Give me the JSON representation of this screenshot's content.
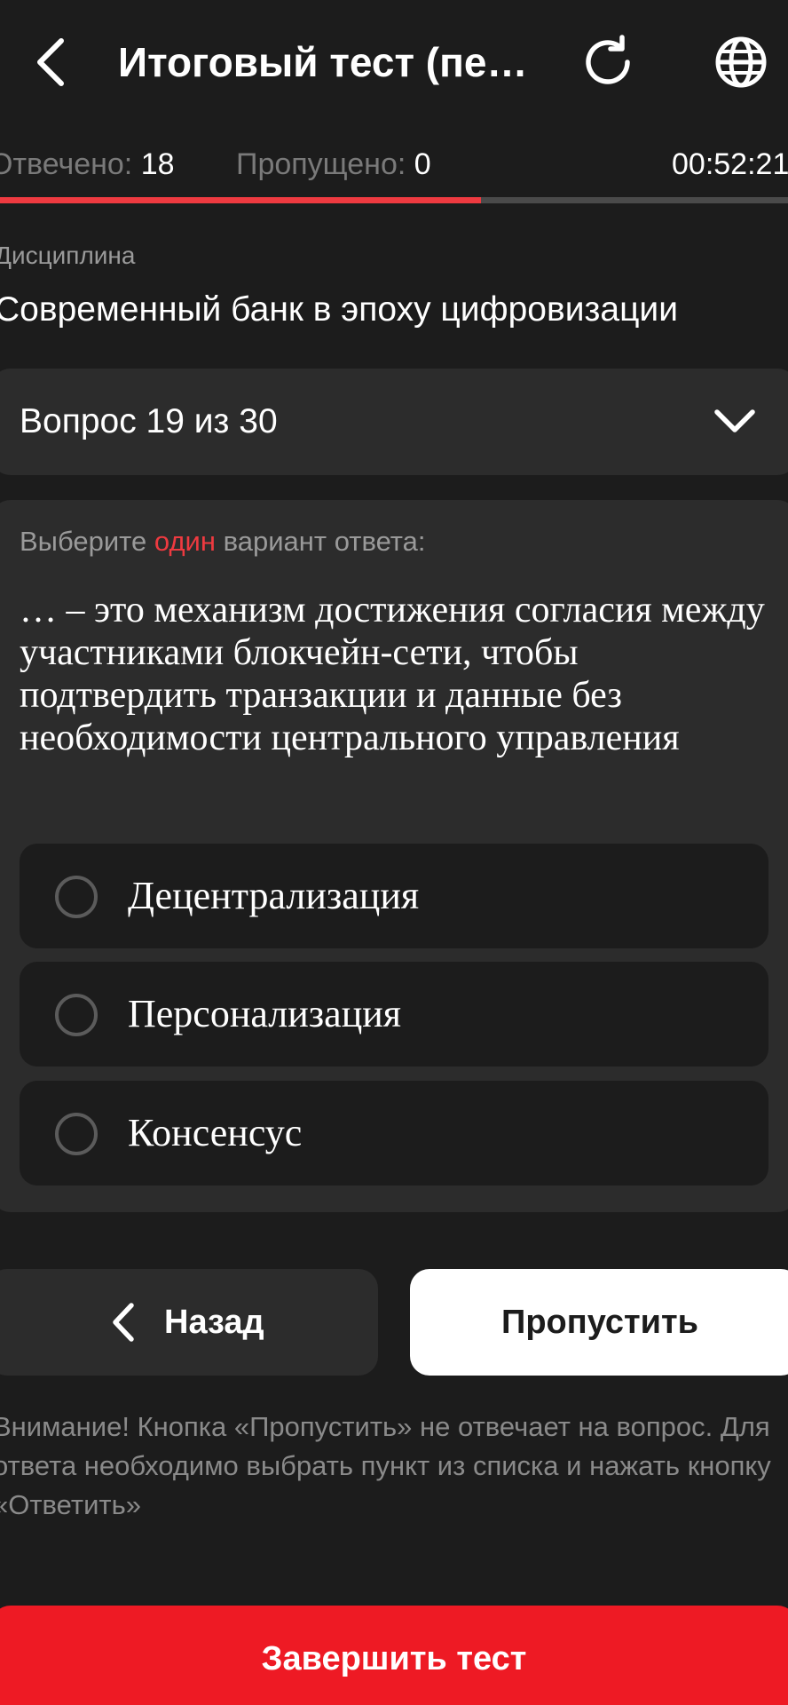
{
  "header": {
    "title": "Итоговый тест (пе…",
    "back_icon": "chevron-left-icon",
    "reload_icon": "reload-icon",
    "globe_icon": "globe-icon"
  },
  "status": {
    "answered_label": "Отвечено:",
    "answered_value": "18",
    "skipped_label": "Пропущено:",
    "skipped_value": "0",
    "timer": "00:52:21",
    "progress_fraction": 0.61
  },
  "discipline": {
    "label": "Дисциплина",
    "name": "Современный банк в эпоху цифровизации"
  },
  "question_selector": {
    "label": "Вопрос 19 из 30",
    "icon": "chevron-down-icon"
  },
  "question": {
    "hint_prefix": "Выберите",
    "hint_accent": "один",
    "hint_suffix": "вариант ответа:",
    "text": "… – это механизм достижения согласия между участниками блокчейн-сети, чтобы подтвердить транзакции и данные без необходимости центрального управления",
    "options": [
      {
        "label": "Децентрализация"
      },
      {
        "label": "Персонализация"
      },
      {
        "label": "Консенсус"
      }
    ]
  },
  "actions": {
    "back_label": "Назад",
    "skip_label": "Пропустить",
    "finish_label": "Завершить тест"
  },
  "warning": "Внимание! Кнопка «Пропустить» не отвечает на вопрос. Для ответа необходимо выбрать пункт из списка и нажать кнопку «Ответить»",
  "colors": {
    "background": "#1c1c1c",
    "surface": "#2c2c2c",
    "accent": "#ee3a40",
    "finish": "#ee1a24"
  }
}
